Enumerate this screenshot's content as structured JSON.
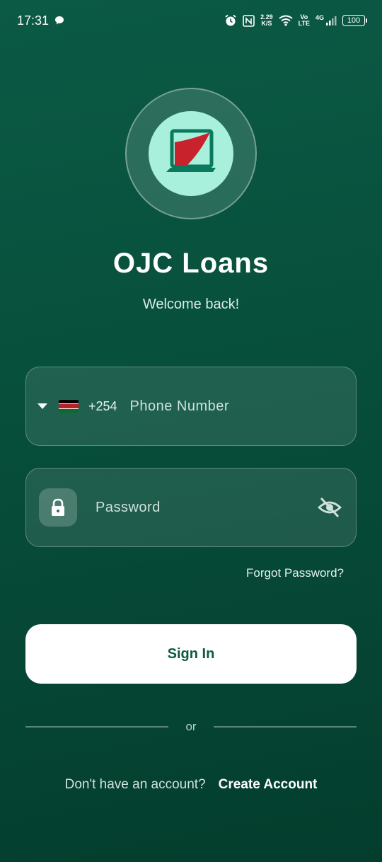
{
  "status_bar": {
    "time": "17:31",
    "net_speed": "2.29",
    "net_unit": "K/S",
    "volte_top": "Vo",
    "volte_bottom": "LTE",
    "signal_type": "4G",
    "battery": "100",
    "icons": [
      "chat-bubble-icon",
      "alarm-icon",
      "nfc-icon",
      "wifi-icon",
      "signal-icon",
      "battery-icon"
    ]
  },
  "app": {
    "title": "OJC Loans",
    "subtitle": "Welcome back!",
    "logo_icon": "laptop-logo-icon"
  },
  "phone_field": {
    "country_code": "+254",
    "flag": "kenya-flag-icon",
    "placeholder": "Phone Number"
  },
  "password_field": {
    "placeholder": "Password",
    "lock_icon": "lock-icon",
    "visibility_icon": "eye-off-icon"
  },
  "forgot_password": "Forgot Password?",
  "sign_in_label": "Sign In",
  "divider_text": "or",
  "no_account_text": "Don't have an account?",
  "create_account_label": "Create Account",
  "colors": {
    "background": "#07503c",
    "accent_mint": "#a8f0dc",
    "button_text": "#0b5a45",
    "logo_red": "#c8232c"
  }
}
